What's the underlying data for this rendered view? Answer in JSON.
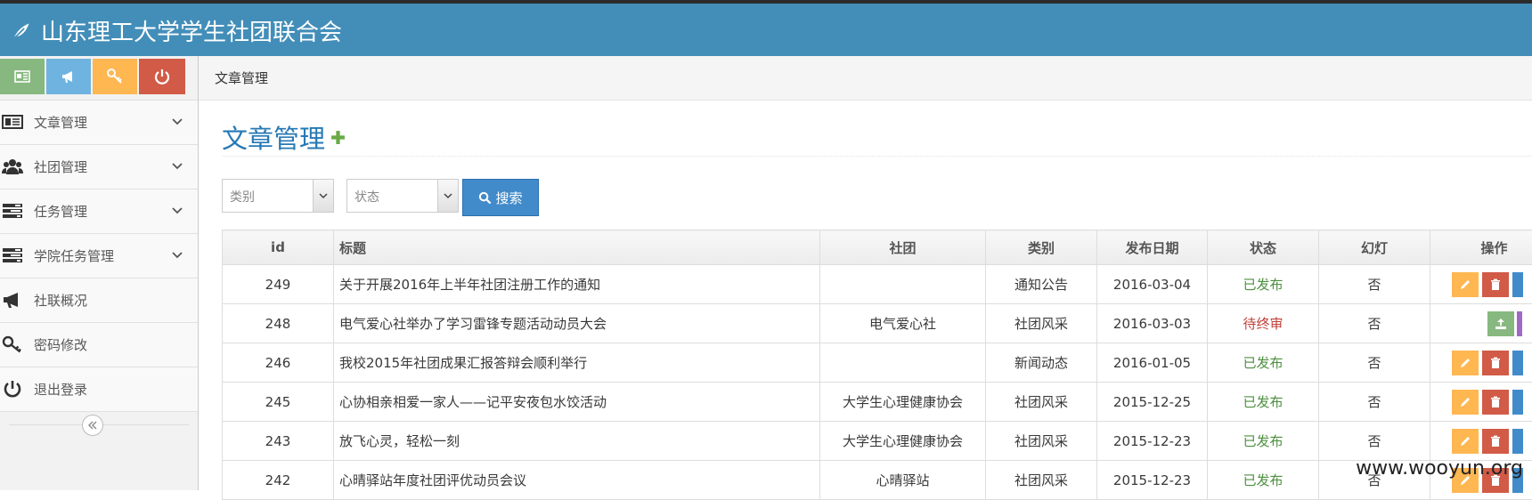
{
  "app": {
    "title": "山东理工大学学生社团联合会"
  },
  "shortcuts": [
    {
      "icon": "newspaper-icon",
      "color": "#87b87f"
    },
    {
      "icon": "bullhorn-icon",
      "color": "#6fb3e0"
    },
    {
      "icon": "key-icon",
      "color": "#ffb752"
    },
    {
      "icon": "power-icon",
      "color": "#d15b47"
    }
  ],
  "sidebar": {
    "items": [
      {
        "label": "文章管理",
        "icon": "newspaper-icon",
        "has_submenu": true
      },
      {
        "label": "社团管理",
        "icon": "users-icon",
        "has_submenu": true
      },
      {
        "label": "任务管理",
        "icon": "tasks-icon",
        "has_submenu": true
      },
      {
        "label": "学院任务管理",
        "icon": "tasks-icon",
        "has_submenu": true
      },
      {
        "label": "社联概况",
        "icon": "bullhorn-icon",
        "has_submenu": false
      },
      {
        "label": "密码修改",
        "icon": "key-icon",
        "has_submenu": false
      },
      {
        "label": "退出登录",
        "icon": "power-icon",
        "has_submenu": false
      }
    ]
  },
  "breadcrumb": "文章管理",
  "page_title": "文章管理",
  "filters": {
    "category": "类别",
    "status": "状态",
    "search_label": "搜索"
  },
  "table": {
    "columns": [
      "id",
      "标题",
      "社团",
      "类别",
      "发布日期",
      "状态",
      "幻灯",
      "操作"
    ],
    "rows": [
      {
        "id": "249",
        "title": "关于开展2016年上半年社团注册工作的通知",
        "club": "",
        "category": "通知公告",
        "date": "2016-03-04",
        "status": "已发布",
        "slide": "否",
        "actions": "edit-delete"
      },
      {
        "id": "248",
        "title": "电气爱心社举办了学习雷锋专题活动动员大会",
        "club": "电气爱心社",
        "category": "社团风采",
        "date": "2016-03-03",
        "status": "待终审",
        "slide": "否",
        "actions": "publish"
      },
      {
        "id": "246",
        "title": "我校2015年社团成果汇报答辩会顺利举行",
        "club": "",
        "category": "新闻动态",
        "date": "2016-01-05",
        "status": "已发布",
        "slide": "否",
        "actions": "edit-delete"
      },
      {
        "id": "245",
        "title": "心协相亲相爱一家人——记平安夜包水饺活动",
        "club": "大学生心理健康协会",
        "category": "社团风采",
        "date": "2015-12-25",
        "status": "已发布",
        "slide": "否",
        "actions": "edit-delete"
      },
      {
        "id": "243",
        "title": "放飞心灵，轻松一刻",
        "club": "大学生心理健康协会",
        "category": "社团风采",
        "date": "2015-12-23",
        "status": "已发布",
        "slide": "否",
        "actions": "edit-delete"
      },
      {
        "id": "242",
        "title": "心晴驿站年度社团评优动员会议",
        "club": "心晴驿站",
        "category": "社团风采",
        "date": "2015-12-23",
        "status": "已发布",
        "slide": "否",
        "actions": "edit-delete"
      }
    ]
  },
  "colors": {
    "navbar": "#438eb9",
    "published": "#4c8f3f",
    "pending": "#c0403a",
    "edit": "#ffb752",
    "delete": "#d15b47",
    "publish": "#87b87f",
    "primary": "#428bca"
  },
  "watermark": "www.wooyun.org"
}
